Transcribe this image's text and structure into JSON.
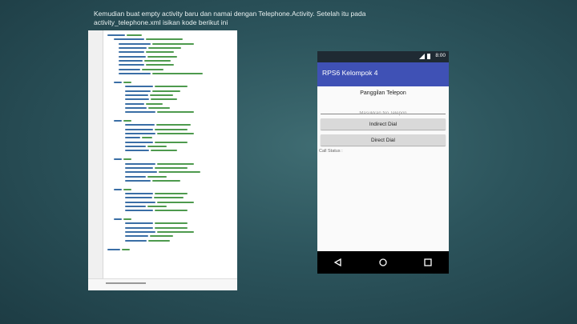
{
  "slide": {
    "caption": "Kemudian buat empty activity baru dan namai dengan Telephone.Activity. Setelah itu pada activity_telephone.xml isikan kode berikut ini"
  },
  "phone": {
    "status_time": "8:00",
    "app_title": "RPS6 Kelompok 4",
    "heading": "Panggilan Telepon",
    "phone_placeholder": "Masukkan No Telepon",
    "indirect_button": "Indirect Dial",
    "direct_button": "Direct Dial",
    "call_status": "Call Status :",
    "nav": [
      "back-icon",
      "home-icon",
      "recent-apps-icon"
    ]
  },
  "colors": {
    "appbar": "#3f51b5",
    "background": "#2c545c"
  }
}
